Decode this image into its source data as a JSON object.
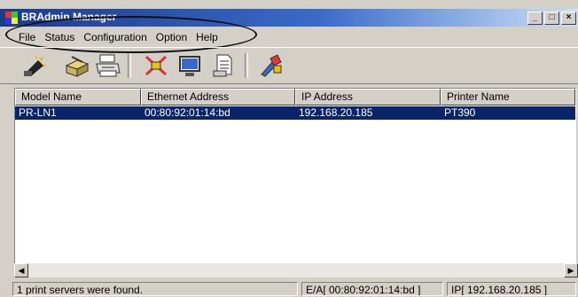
{
  "window": {
    "title": "BRAdmin Manager",
    "minimize_glyph": "_",
    "restore_glyph": "□",
    "close_glyph": "×"
  },
  "menu": [
    "File",
    "Status",
    "Configuration",
    "Option",
    "Help"
  ],
  "toolbar": {
    "buttons": [
      "search-printer-icon",
      "configure-printer-icon",
      "print-server-icon",
      "disconnect-icon",
      "web-browser-icon",
      "settings-tool-icon",
      "color-printer-icon"
    ]
  },
  "table": {
    "columns": [
      "Model Name",
      "Ethernet Address",
      "IP Address",
      "Printer Name"
    ],
    "rows": [
      [
        "PR-LN1",
        "00:80:92:01:14:bd",
        "192.168.20.185",
        "PT390"
      ]
    ]
  },
  "status": {
    "message": "1 print servers were found.",
    "ethernet": "E/A[ 00:80:92:01:14:bd ]",
    "ip": "IP[ 192.168.20.185 ]"
  },
  "colors": {
    "selection": "#0a246a",
    "title_gradient_start": "#1c3b8a",
    "face": "#d4d0c8"
  }
}
